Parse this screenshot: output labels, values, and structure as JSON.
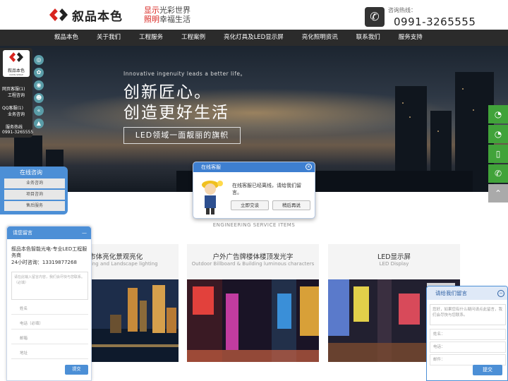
{
  "header": {
    "logo_text": "叙品本色",
    "logo_en": "XUPIN SENSE INTELLIGI",
    "slogan_red_1": "显示",
    "slogan_1": "光彩世界",
    "slogan_red_2": "照明",
    "slogan_2": "幸福生活",
    "hotline_label": "咨询热线：",
    "hotline_number": "0991-3265555"
  },
  "nav": {
    "items": [
      {
        "label": "叙品本色"
      },
      {
        "label": "关于我们"
      },
      {
        "label": "工程服务"
      },
      {
        "label": "工程案例"
      },
      {
        "label": "亮化灯具及LED显示屏"
      },
      {
        "label": "亮化照明资讯"
      },
      {
        "label": "联系我们"
      },
      {
        "label": "服务支持"
      }
    ]
  },
  "hero": {
    "subtitle": "Innovative ingenuity leads a better life。",
    "title_1": "创新匠心。",
    "title_2": "创造更好生活",
    "tag": "LED领域一面靓丽的旗帜"
  },
  "section": {
    "en_title": "ENGINEERING SERVICE ITEMS"
  },
  "cards": [
    {
      "title": "城市体亮化景观亮化",
      "subtitle": "City Lighting and Landscape lighting"
    },
    {
      "title": "户外广告牌楼体楼顶发光字",
      "subtitle": "Outdoor Billboard & Building luminous characters"
    },
    {
      "title": "LED显示屏",
      "subtitle": "LED Display"
    }
  ],
  "left_dock": {
    "logo_text": "叙品本色",
    "logo_en": "XUPIN SENSE",
    "web_service": "网页客服(1)",
    "engineer": "工程咨询",
    "qq_service": "QQ客服(1)",
    "business": "业务咨询",
    "hotline_label": "服务热线",
    "hotline": "0991-3265555"
  },
  "consult": {
    "title": "在线咨询",
    "items": [
      "业务咨询",
      "项目咨询",
      "售后服务"
    ]
  },
  "message_left": {
    "title": "请您留言",
    "minimize": "—",
    "company": "叙品本色智能光电-专业LED工程服务商",
    "hotline": "24小时咨询：13319877268",
    "placeholder": "请在此输入留言内容，我们会尽快与您联系。（必填）",
    "fields": [
      "姓名",
      "电话（必填）",
      "邮箱",
      "地址"
    ],
    "submit": "提交"
  },
  "chat_popup": {
    "title": "在线客服",
    "close": "×",
    "message": "在线客服已经离线，请给我们留言。",
    "btn_primary": "立即交谈",
    "btn_secondary": "稍后再说"
  },
  "message_right": {
    "title": "请给我们留言",
    "minimize": "−",
    "placeholder": "您好，如果您有什么疑问请点此留言，我们会尽快与您联系。",
    "fields": [
      "姓名：",
      "电话：",
      "邮件："
    ],
    "submit": "提交"
  },
  "right_bar": {
    "icons": [
      "qq-icon",
      "qq-icon",
      "mobile-icon",
      "phone-icon",
      "back-to-top-icon"
    ]
  },
  "colors": {
    "brand_red": "#d8241f",
    "nav_bg": "#2b2b2b",
    "accent_blue": "#4c8fd6",
    "side_green": "#41a33a"
  }
}
